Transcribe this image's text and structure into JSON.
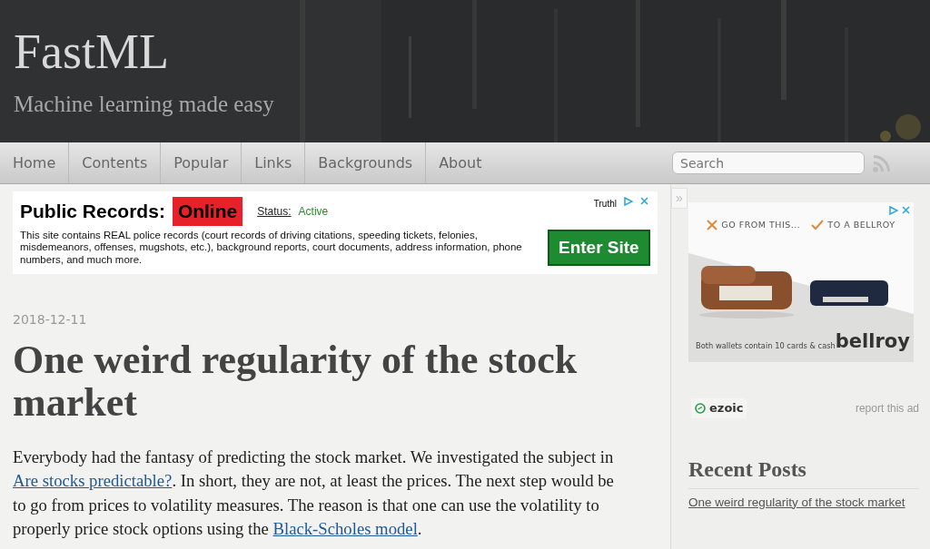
{
  "site": {
    "title": "FastML",
    "tagline": "Machine learning made easy"
  },
  "nav": {
    "items": [
      {
        "label": "Home"
      },
      {
        "label": "Contents"
      },
      {
        "label": "Popular"
      },
      {
        "label": "Links"
      },
      {
        "label": "Backgrounds"
      },
      {
        "label": "About"
      }
    ],
    "search": {
      "placeholder": "Search"
    }
  },
  "top_ad": {
    "headline": "Public Records:",
    "highlight": "Online",
    "status_label": "Status:",
    "status_value": "Active",
    "brand": "Truthl",
    "body": "This site contains REAL police records (court records of driving citations, speeding tickets, felonies, misdemeanors, offenses, mugshots, etc.), background reports, court documents, address information, phone numbers, and much more.",
    "button": "Enter Site"
  },
  "post": {
    "date": "2018-12-11",
    "title": "One weird regularity of the stock market",
    "paragraph": [
      {
        "kind": "text",
        "text": "Everybody had the fantasy of predicting the stock market. We investigated the subject in "
      },
      {
        "kind": "link",
        "text": "Are stocks predictable?"
      },
      {
        "kind": "text",
        "text": ". In short, they are not, at least the prices. The next step would be to go from prices to volatility measures. The reason is that one can use the volatility to properly price stock options using the "
      },
      {
        "kind": "link",
        "text": "Black-Scholes model"
      },
      {
        "kind": "text",
        "text": "."
      }
    ]
  },
  "sidebar": {
    "collapse_glyph": "»"
  },
  "side_ad": {
    "left_caption": "GO FROM THIS...",
    "right_caption": "TO A BELLROY",
    "footer": "Both wallets contain 10 cards & cash",
    "brand": "bellroy",
    "network": "ezoic",
    "report": "report this ad"
  },
  "recent_posts": {
    "heading": "Recent Posts",
    "items": [
      {
        "title": "One weird regularity of the stock market"
      }
    ]
  }
}
